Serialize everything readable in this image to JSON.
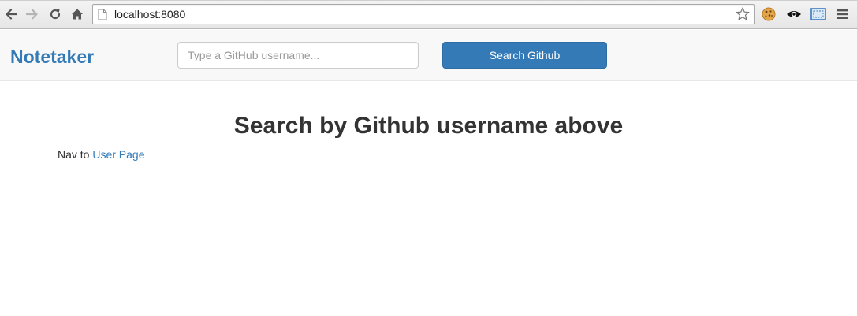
{
  "browser": {
    "url": "localhost:8080",
    "icons": {
      "back": "back-arrow-icon",
      "forward": "forward-arrow-icon",
      "reload": "reload-icon",
      "home": "home-icon",
      "page": "page-icon",
      "bookmark": "star-icon",
      "extension_1": "cookie-icon",
      "extension_2": "eye-icon",
      "extension_3": "screen-icon",
      "menu": "hamburger-menu-icon"
    }
  },
  "navbar": {
    "brand": "Notetaker",
    "search": {
      "placeholder": "Type a GitHub username...",
      "value": ""
    },
    "search_button_label": "Search Github"
  },
  "main": {
    "heading": "Search by Github username above",
    "nav_prefix": "Nav to",
    "nav_link_label": "User Page"
  },
  "colors": {
    "brand_blue": "#337ab7",
    "navbar_bg": "#f8f8f8",
    "heading_text": "#333333"
  }
}
